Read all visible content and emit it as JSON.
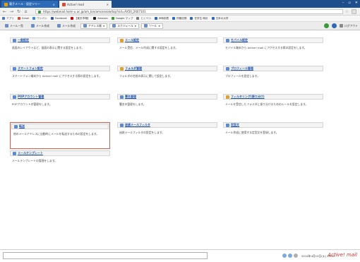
{
  "browser": {
    "tabs": [
      {
        "label": "電子メール - 設定ツリー"
      },
      {
        "label": "Active! mail"
      }
    ],
    "url": "https://webmail.homi-u.ac.jp/am_bin/amconsole/top?sid=AX50_2007101",
    "bookmarks": [
      {
        "label": "アプリ",
        "color": "#4a78c2"
      },
      {
        "label": "Gmail",
        "color": "#d84a3a"
      },
      {
        "label": "ワンパン",
        "color": "#3a8ad8"
      },
      {
        "label": "Facebook",
        "color": "#3b5998"
      },
      {
        "label": "【楽天市場】",
        "color": "#bf0000"
      },
      {
        "label": "Amazon",
        "color": "#222222"
      },
      {
        "label": "Google マップ",
        "color": "#3a9a3a"
      },
      {
        "label": "とくべつ",
        "color": "#7a7a7a"
      },
      {
        "label": "JR時刻表",
        "color": "#2a6ab8"
      },
      {
        "label": "所管記録",
        "color": "#2a6ab8"
      },
      {
        "label": "在学生 時計",
        "color": "#2a6ab8"
      },
      {
        "label": "日本の大学",
        "color": "#2a6ab8"
      }
    ]
  },
  "toolbar": {
    "items": [
      {
        "label": "メール一覧",
        "boxed": false
      },
      {
        "label": "メール作成",
        "boxed": false
      },
      {
        "label": "メール作成",
        "boxed": false
      },
      {
        "label": "アドレス帳",
        "boxed": true
      },
      {
        "label": "スケジュール",
        "boxed": true
      },
      {
        "label": "ツール",
        "boxed": true
      }
    ],
    "logout_label": "ログアウト"
  },
  "cards": [
    {
      "title": "一般設定",
      "desc": "画面のレイアウトなど、画面の表示に関する設定をします。",
      "icon_color": "#5b8ad0"
    },
    {
      "title": "メール設定",
      "desc": "メール受信、メール作成に関する設定をします。",
      "icon_color": "#e0a030"
    },
    {
      "title": "モバイル設定",
      "desc": "モバイル端末から Active! mail にアクセスする際の設定をします。",
      "icon_color": "#5b8ad0"
    },
    {
      "title": "スマートフォン設定",
      "desc": "スマートフォン端末から Active! mail にアクセスする際の設定をします。",
      "icon_color": "#5b8ad0"
    },
    {
      "title": "フォルダ管理",
      "desc": "フォルダの名前の表示に関して設定します。",
      "icon_color": "#e0a030"
    },
    {
      "title": "プロフィール管理",
      "desc": "プロフィールを設定します。",
      "icon_color": "#5b8ad0"
    },
    {
      "title": "POPアカウント管理",
      "desc": "POPアカウントの管理をします。",
      "icon_color": "#5b8ad0"
    },
    {
      "title": "署名管理",
      "desc": "署名の管理をします。",
      "icon_color": "#5b8ad0"
    },
    {
      "title": "フィルタリング(振り分け)",
      "desc": "メールを受信したフォルダに振り分けるためのルールを設定します。",
      "icon_color": "#e0a030"
    },
    {
      "title": "転送",
      "desc": "他のメールアドレスに自動的にメールを転送するための設定をします。",
      "icon_color": "#5b8ad0"
    },
    {
      "title": "迷惑メールフィルタ",
      "desc": "迷惑メールフィルタの設定をします。",
      "icon_color": "#5b8ad0"
    },
    {
      "title": "定型文",
      "desc": "メール作成に使用する定型文を登録します。",
      "icon_color": "#5b8ad0"
    },
    {
      "title": "メールテンプレート",
      "desc": "メールテンプレートの管理をします。",
      "icon_color": "#5b8ad0"
    }
  ],
  "status": {
    "datetime": "2014年4月15日(火) 15:01",
    "brand": "Active! mail"
  }
}
